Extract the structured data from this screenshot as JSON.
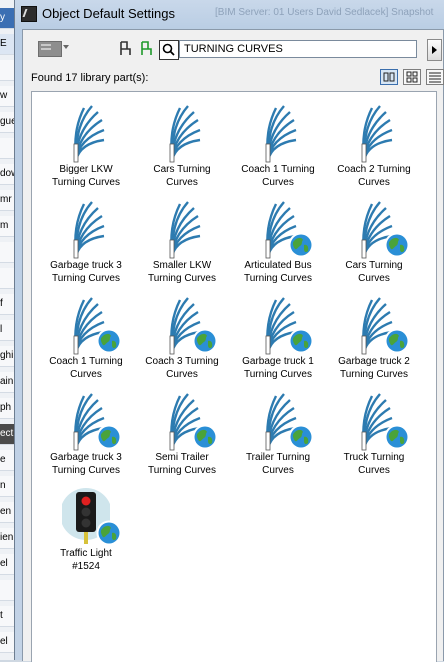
{
  "window": {
    "title": "Object Default Settings",
    "background_title": "[BIM Server: 01 Users David Sedlacek] Snapshot"
  },
  "background_strip": [
    "y",
    "E",
    "",
    "w",
    "gue",
    "",
    "dow",
    "mr",
    "m",
    "",
    "",
    "f",
    "l",
    "ghi",
    "ain",
    "ph",
    "ect",
    "e",
    "n",
    "en",
    "ien",
    "el",
    "",
    "t",
    "el"
  ],
  "toolbar": {
    "preview_icon": "preview-pane-icon",
    "search_icon": "magnifier-icon",
    "search_value": "TURNING CURVES"
  },
  "results": {
    "found_text": "Found 17 library part(s):"
  },
  "view_modes": [
    "large-icons",
    "small-icons",
    "list"
  ],
  "colors": {
    "curve": "#2d7bb0",
    "globe_ocean": "#2a8fd6",
    "globe_land": "#4aa33a",
    "selection": "#d7e6f5"
  },
  "items": [
    {
      "line1": "Bigger LKW",
      "line2": "Turning Curves",
      "globe": false,
      "type": "curves"
    },
    {
      "line1": "Cars Turning",
      "line2": "Curves",
      "globe": false,
      "type": "curves"
    },
    {
      "line1": "Coach 1 Turning",
      "line2": "Curves",
      "globe": false,
      "type": "curves"
    },
    {
      "line1": "Coach 2 Turning",
      "line2": "Curves",
      "globe": false,
      "type": "curves"
    },
    {
      "line1": "Garbage truck 3",
      "line2": "Turning Curves",
      "globe": false,
      "type": "curves"
    },
    {
      "line1": "Smaller LKW",
      "line2": "Turning Curves",
      "globe": false,
      "type": "curves"
    },
    {
      "line1": "Articulated Bus",
      "line2": "Turning Curves",
      "globe": true,
      "type": "curves"
    },
    {
      "line1": "Cars Turning",
      "line2": "Curves",
      "globe": true,
      "type": "curves"
    },
    {
      "line1": "Coach 1 Turning",
      "line2": "Curves",
      "globe": true,
      "type": "curves"
    },
    {
      "line1": "Coach 3 Turning",
      "line2": "Curves",
      "globe": true,
      "type": "curves"
    },
    {
      "line1": "Garbage truck 1",
      "line2": "Turning Curves",
      "globe": true,
      "type": "curves"
    },
    {
      "line1": "Garbage truck 2",
      "line2": "Turning Curves",
      "globe": true,
      "type": "curves"
    },
    {
      "line1": "Garbage truck 3",
      "line2": "Turning Curves",
      "globe": true,
      "type": "curves"
    },
    {
      "line1": "Semi Trailer",
      "line2": "Turning Curves",
      "globe": true,
      "type": "curves"
    },
    {
      "line1": "Trailer Turning",
      "line2": "Curves",
      "globe": true,
      "type": "curves"
    },
    {
      "line1": "Truck Turning",
      "line2": "Curves",
      "globe": true,
      "type": "curves"
    },
    {
      "line1": "Traffic Light",
      "line2": "#1524",
      "globe": true,
      "type": "traffic-light"
    }
  ]
}
